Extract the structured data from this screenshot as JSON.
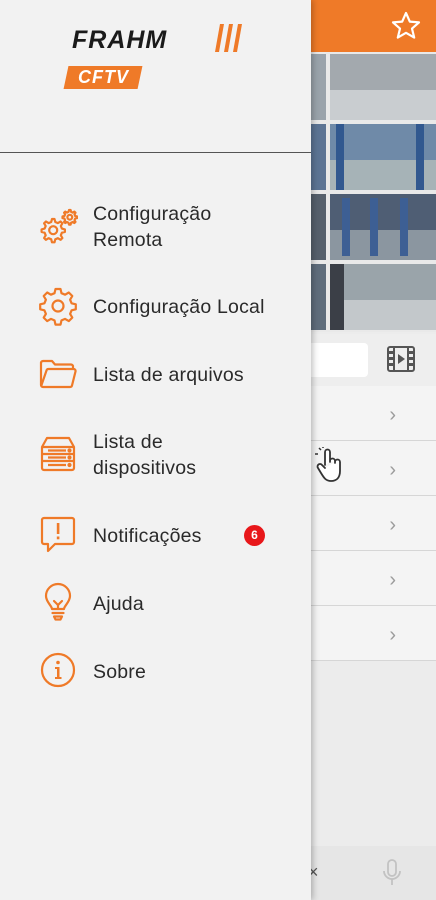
{
  "app": {
    "brand_name": "FRAHM",
    "brand_tag": "CFTV",
    "accent_color": "#ef7a28"
  },
  "menu": {
    "items": [
      {
        "label_line1": "Configuração",
        "label_line2": "Remota",
        "icon": "remote-gears-icon"
      },
      {
        "label": "Configuração Local",
        "icon": "gear-icon"
      },
      {
        "label": "Lista de arquivos",
        "icon": "folder-icon"
      },
      {
        "label_line1": "Lista de",
        "label_line2": "dispositivos",
        "icon": "device-list-icon"
      },
      {
        "label": "Notificações",
        "icon": "alert-message-icon",
        "badge": "6"
      },
      {
        "label": "Ajuda",
        "icon": "lightbulb-icon"
      },
      {
        "label": "Sobre",
        "icon": "info-icon"
      }
    ]
  },
  "background": {
    "close_label": "×",
    "icons": [
      "star-icon",
      "film-icon",
      "hand-pointer-icon",
      "mic-icon"
    ]
  }
}
